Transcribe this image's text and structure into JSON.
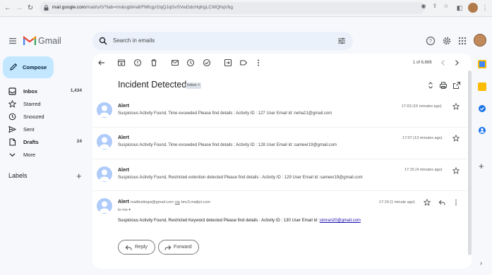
{
  "browser": {
    "url_host": "mail.google.com",
    "url_path": "/mail/u/0/?tab=rm&ogbl#all/FMfcgzGqQJqGvSVwDdcHqKgLCWQhqVbg"
  },
  "header": {
    "app_name": "Gmail",
    "search_placeholder": "Search in emails"
  },
  "sidebar": {
    "compose_label": "Compose",
    "items": [
      {
        "label": "Inbox",
        "count": "1,434",
        "icon": "inbox-icon"
      },
      {
        "label": "Starred",
        "count": "",
        "icon": "star-icon"
      },
      {
        "label": "Snoozed",
        "count": "",
        "icon": "clock-icon"
      },
      {
        "label": "Sent",
        "count": "",
        "icon": "send-icon"
      },
      {
        "label": "Drafts",
        "count": "24",
        "icon": "draft-icon"
      },
      {
        "label": "More",
        "count": "",
        "icon": "chevron-down-icon"
      }
    ],
    "labels_heading": "Labels"
  },
  "toolbar": {
    "paging": "1 of 6,666"
  },
  "thread": {
    "subject": "Incident Detected",
    "label_badge": "Inbox",
    "messages": [
      {
        "sender": "Alert",
        "body": "Suspicious Activity Found, Time exceeded Please find details : Activity ID : 127 User Email Id :neha21@gmail.com",
        "time": "17:03 (16 minutes ago)"
      },
      {
        "sender": "Alert",
        "body": "Suspicious Activity Found, Time exceeded Please find details : Activity ID : 128 User Email Id :sameer19@gmail.com",
        "time": "17:07 (13 minutes ago)"
      },
      {
        "sender": "Alert",
        "body": "Suspicious Activity Found, Restricted extention detected Please find details : Activity ID : 129 User Email id :sameer19@gmail.com",
        "time": "17:15 (4 minutes ago)"
      }
    ],
    "expanded": {
      "sender": "Alert",
      "sender_email": "mailtestingw@gmail.com",
      "via_label": "via",
      "via_domain": "bnc3.mailjet.com",
      "to_line": "to me",
      "time": "17:19 (1 minute ago)",
      "body_prefix": "Suspicious Activity Found, Restricted Keyword detected Please find details : Activity ID : 130 User Email Id :",
      "body_link": "simran20@gmail.com"
    },
    "reply_label": "Reply",
    "forward_label": "Forward"
  }
}
